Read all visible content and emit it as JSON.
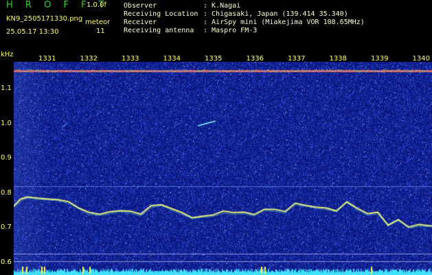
{
  "header": {
    "app_title": "H R O F F T",
    "version": "1.0.0f",
    "filename": "KN9_2505171330.png",
    "datetime": "25.05.17 13:30",
    "meteor_label": "meteor",
    "meteor_count": "11"
  },
  "info": [
    {
      "key": "Observer",
      "value": ": K.Nagai"
    },
    {
      "key": "Receiving Location",
      "value": ": Chigasaki, Japan (139.414 35.340)"
    },
    {
      "key": "Receiver",
      "value": ": AirSpy mini (Miakejima VOR 108.65MHz)"
    },
    {
      "key": "Receiving antenna",
      "value": ": Maspro FM-3"
    }
  ],
  "axis": {
    "y_unit": "kHz",
    "y_ticks": [
      "1.1",
      "1.0",
      "0.9",
      "0.8",
      "0.7",
      "0.6"
    ],
    "x_ticks": [
      "1331",
      "1332",
      "1333",
      "1334",
      "1335",
      "1336",
      "1337",
      "1338",
      "1339",
      "1340"
    ]
  },
  "colors": {
    "background": "#000000",
    "noise": "#1a2fb0",
    "signal": "#f0f080",
    "header_text": "#ffff66",
    "title_text": "#2fd12f"
  }
}
